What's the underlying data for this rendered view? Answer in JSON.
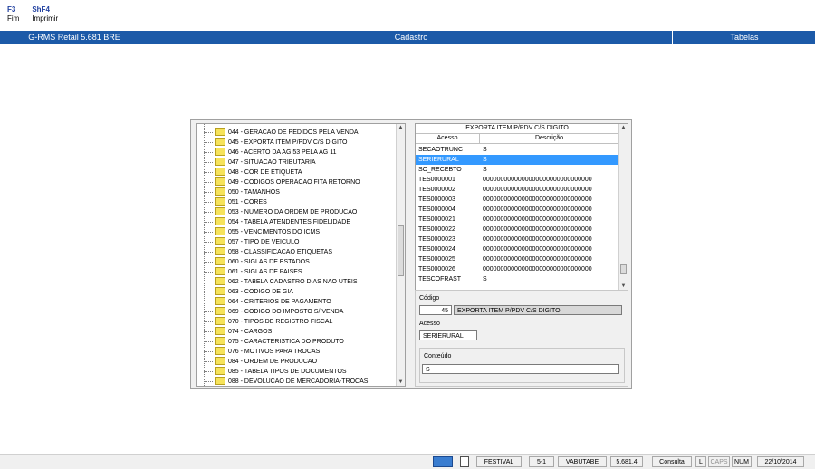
{
  "hotkeys": [
    {
      "key": "F3",
      "label": "Fim"
    },
    {
      "key": "ShF4",
      "label": "Imprimir"
    }
  ],
  "titlebar": {
    "app": "G-RMS Retail 5.681 BRE",
    "screen": "Cadastro",
    "section": "Tabelas",
    "background": "#1c5aa8"
  },
  "tree": {
    "items": [
      "044 - GERACAO DE PEDIDOS PELA VENDA",
      "045 - EXPORTA ITEM P/PDV C/S DIGITO",
      "046 - ACERTO DA AG 53 PELA AG 11",
      "047 - SITUACAO TRIBUTARIA",
      "048 - COR DE ETIQUETA",
      "049 - CODIGOS OPERACAO FITA RETORNO",
      "050 - TAMANHOS",
      "051 - CORES",
      "053 - NUMERO DA ORDEM DE PRODUCAO",
      "054 - TABELA ATENDENTES FIDELIDADE",
      "055 - VENCIMENTOS DO ICMS",
      "057 - TIPO DE VEICULO",
      "058 - CLASSIFICACAO ETIQUETAS",
      "060 - SIGLAS DE ESTADOS",
      "061 - SIGLAS DE PAISES",
      "062 - TABELA CADASTRO DIAS NAO UTEIS",
      "063 - CODIGO DE GIA",
      "064 - CRITERIOS DE PAGAMENTO",
      "069 - CODIGO DO IMPOSTO S/ VENDA",
      "070 - TIPOS DE REGISTRO FISCAL",
      "074 - CARGOS",
      "075 - CARACTERISTICA DO PRODUTO",
      "076 - MOTIVOS PARA TROCAS",
      "084 - ORDEM DE PRODUCAO",
      "085 - TABELA TIPOS DE DOCUMENTOS",
      "088 - DEVOLUCAO DE MERCADORIA-TROCAS"
    ],
    "folder_icon": "folder-icon"
  },
  "grid": {
    "title": "EXPORTA ITEM P/PDV C/S DIGITO",
    "columns": [
      "Acesso",
      "Descrição"
    ],
    "rows": [
      [
        "SECAOTRUNC",
        "S"
      ],
      [
        "SERIERURAL",
        "S"
      ],
      [
        "SO_RECEBTO",
        "S"
      ],
      [
        "TES0000001",
        "0000000000000000000000000000000"
      ],
      [
        "TES0000002",
        "0000000000000000000000000000000"
      ],
      [
        "TES0000003",
        "0000000000000000000000000000000"
      ],
      [
        "TES0000004",
        "0000000000000000000000000000000"
      ],
      [
        "TES0000021",
        "0000000000000000000000000000000"
      ],
      [
        "TES0000022",
        "0000000000000000000000000000000"
      ],
      [
        "TES0000023",
        "0000000000000000000000000000000"
      ],
      [
        "TES0000024",
        "0000000000000000000000000000000"
      ],
      [
        "TES0000025",
        "0000000000000000000000000000000"
      ],
      [
        "TES0000026",
        "0000000000000000000000000000000"
      ],
      [
        "TESCOFRAST",
        "S"
      ]
    ],
    "selected_index": 1,
    "selected_color": "#3399ff"
  },
  "detail": {
    "codigo_label": "Código",
    "codigo_value": "45",
    "codigo_desc": "EXPORTA ITEM P/PDV C/S DIGITO",
    "acesso_label": "Acesso",
    "acesso_value": "SERIERURAL",
    "conteudo_label": "Conteúdo",
    "conteudo_value": "S"
  },
  "statusbar": {
    "fields": [
      "FESTIVAL",
      "5-1",
      "VABUTABE",
      "5.681.4",
      "Consulta",
      "L",
      "CAPS",
      "NUM",
      "22/10/2014"
    ]
  }
}
